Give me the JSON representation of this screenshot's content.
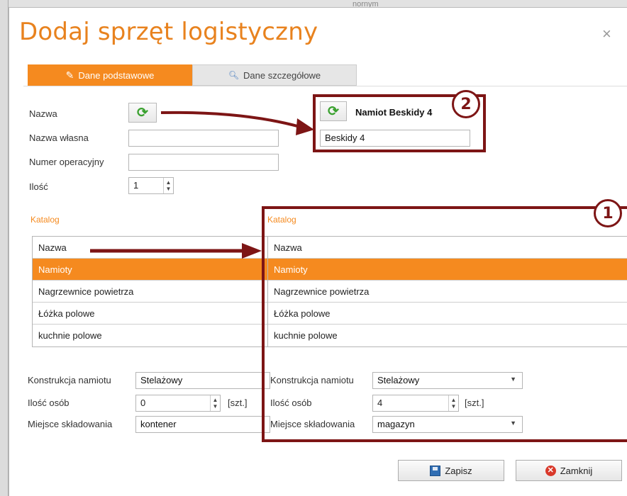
{
  "background": {
    "fragment": "nornym"
  },
  "dialog": {
    "title": "Dodaj sprzęt logistyczny",
    "close_glyph": "×",
    "tabs": [
      {
        "label": "Dane podstawowe",
        "icon": "pencil-icon",
        "active": true
      },
      {
        "label": "Dane szczegółowe",
        "icon": "magnifier-icon",
        "active": false
      }
    ]
  },
  "form": {
    "name_label": "Nazwa",
    "own_name_label": "Nazwa własna",
    "own_name_value": "",
    "operational_number_label": "Numer operacyjny",
    "operational_number_value": "",
    "quantity_label": "Ilość",
    "quantity_value": "1"
  },
  "catalog": {
    "section_label": "Katalog",
    "header": "Nazwa",
    "items": [
      "Namioty",
      "Nagrzewnice powietrza",
      "Łóżka polowe",
      "kuchnie polowe"
    ],
    "selected": "Namioty"
  },
  "details_left": {
    "construction_label": "Konstrukcja namiotu",
    "construction_value": "Stelażowy",
    "persons_label": "Ilość osób",
    "persons_value": "0",
    "unit": "[szt.]",
    "storage_label": "Miejsce składowania",
    "storage_value": "kontener"
  },
  "callout2": {
    "marker": "2",
    "name_value": "Namiot Beskidy 4",
    "own_name_value": "Beskidy 4"
  },
  "callout1": {
    "marker": "1",
    "section_label": "Katalog",
    "header": "Nazwa",
    "items": [
      "Namioty",
      "Nagrzewnice powietrza",
      "Łóżka polowe",
      "kuchnie polowe"
    ],
    "selected": "Namioty",
    "construction_label": "Konstrukcja namiotu",
    "construction_value": "Stelażowy",
    "persons_label": "Ilość osób",
    "persons_value": "4",
    "unit": "[szt.]",
    "storage_label": "Miejsce składowania",
    "storage_value": "magazyn"
  },
  "footer": {
    "save_label": "Zapisz",
    "close_label": "Zamknij"
  },
  "colors": {
    "accent": "#f58a1f",
    "callout": "#7d1515",
    "refresh": "#3aa12f"
  }
}
